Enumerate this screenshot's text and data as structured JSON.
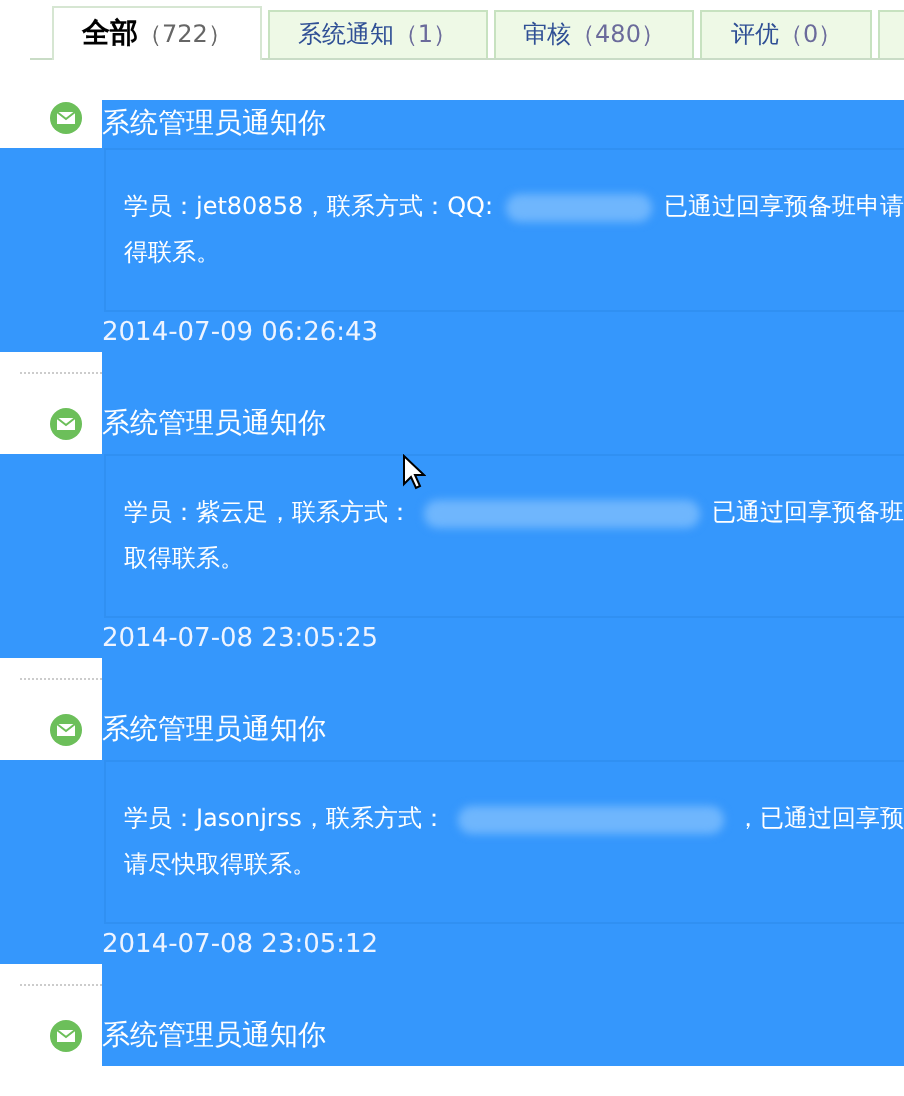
{
  "tabs": [
    {
      "name": "全部",
      "count": "（722）",
      "selected": true
    },
    {
      "name": "系统通知",
      "count": "（1）",
      "selected": false
    },
    {
      "name": "审核",
      "count": "（480）",
      "selected": false
    },
    {
      "name": "评优",
      "count": "（0）",
      "selected": false
    }
  ],
  "messages": [
    {
      "title": "系统管理员通知你",
      "body_start": "学员：jet80858，联系方式：QQ:",
      "body_end": "已通过回享预备班申请",
      "body_line_2": "得联系。",
      "time": "2014-07-09 06:26:43"
    },
    {
      "title": "系统管理员通知你",
      "body_start": "学员：紫云足，联系方式：",
      "body_end": "已通过回享预备班",
      "body_line_2": "取得联系。",
      "time": "2014-07-08 23:05:25"
    },
    {
      "title": "系统管理员通知你",
      "body_start": "学员：Jasonjrss，联系方式：",
      "body_end": "，已通过回享预",
      "body_line_2": "请尽快取得联系。",
      "time": "2014-07-08 23:05:12"
    },
    {
      "title": "系统管理员通知你"
    }
  ]
}
